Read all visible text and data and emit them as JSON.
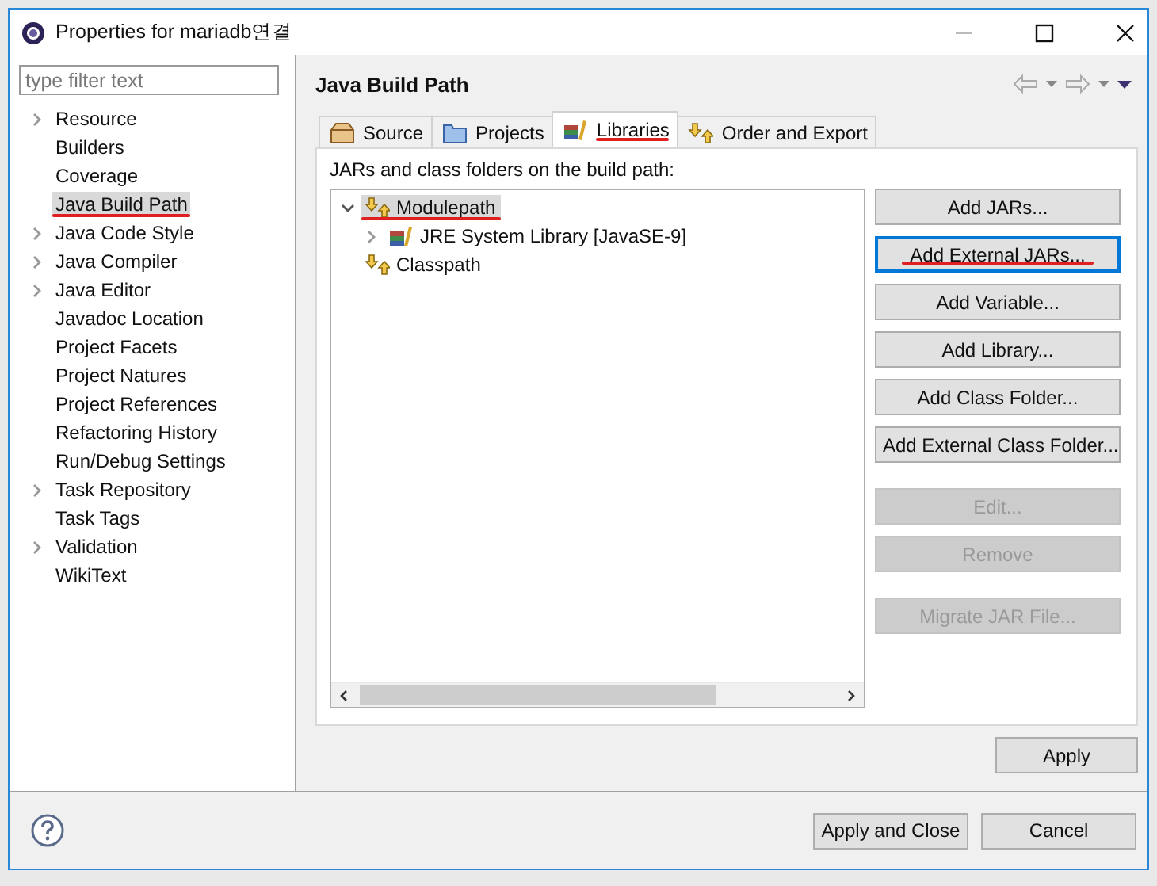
{
  "window": {
    "title": "Properties for mariadb연결"
  },
  "filter": {
    "placeholder": "type filter text"
  },
  "sidebar": {
    "items": [
      {
        "label": "Resource",
        "expandable": true,
        "selected": false,
        "underlined": false
      },
      {
        "label": "Builders",
        "expandable": false,
        "selected": false,
        "underlined": false
      },
      {
        "label": "Coverage",
        "expandable": false,
        "selected": false,
        "underlined": false
      },
      {
        "label": "Java Build Path",
        "expandable": false,
        "selected": true,
        "underlined": true
      },
      {
        "label": "Java Code Style",
        "expandable": true,
        "selected": false,
        "underlined": false
      },
      {
        "label": "Java Compiler",
        "expandable": true,
        "selected": false,
        "underlined": false
      },
      {
        "label": "Java Editor",
        "expandable": true,
        "selected": false,
        "underlined": false
      },
      {
        "label": "Javadoc Location",
        "expandable": false,
        "selected": false,
        "underlined": false
      },
      {
        "label": "Project Facets",
        "expandable": false,
        "selected": false,
        "underlined": false
      },
      {
        "label": "Project Natures",
        "expandable": false,
        "selected": false,
        "underlined": false
      },
      {
        "label": "Project References",
        "expandable": false,
        "selected": false,
        "underlined": false
      },
      {
        "label": "Refactoring History",
        "expandable": false,
        "selected": false,
        "underlined": false
      },
      {
        "label": "Run/Debug Settings",
        "expandable": false,
        "selected": false,
        "underlined": false
      },
      {
        "label": "Task Repository",
        "expandable": true,
        "selected": false,
        "underlined": false
      },
      {
        "label": "Task Tags",
        "expandable": false,
        "selected": false,
        "underlined": false
      },
      {
        "label": "Validation",
        "expandable": true,
        "selected": false,
        "underlined": false
      },
      {
        "label": "WikiText",
        "expandable": false,
        "selected": false,
        "underlined": false
      }
    ]
  },
  "page": {
    "title": "Java Build Path"
  },
  "tabs": [
    {
      "label": "Source",
      "kind": "source",
      "selected": false,
      "underlined": false
    },
    {
      "label": "Projects",
      "kind": "projects",
      "selected": false,
      "underlined": false
    },
    {
      "label": "Libraries",
      "kind": "libraries",
      "selected": true,
      "underlined": true
    },
    {
      "label": "Order and Export",
      "kind": "order",
      "selected": false,
      "underlined": false
    }
  ],
  "description": "JARs and class folders on the build path:",
  "tree": [
    {
      "label": "Modulepath",
      "kind": "path",
      "expanded": true,
      "selected": true,
      "underlined": true,
      "children": [
        {
          "label": "JRE System Library [JavaSE-9]",
          "kind": "library",
          "expanded": false,
          "selected": false,
          "underlined": false
        }
      ]
    },
    {
      "label": "Classpath",
      "kind": "path",
      "selected": false,
      "underlined": false
    }
  ],
  "button_groups": [
    [
      {
        "label": "Add JARs...",
        "disabled": false,
        "focused": false,
        "underlined": false
      },
      {
        "label": "Add External JARs...",
        "disabled": false,
        "focused": true,
        "underlined": true
      },
      {
        "label": "Add Variable...",
        "disabled": false,
        "focused": false,
        "underlined": false
      },
      {
        "label": "Add Library...",
        "disabled": false,
        "focused": false,
        "underlined": false
      },
      {
        "label": "Add Class Folder...",
        "disabled": false,
        "focused": false,
        "underlined": false
      },
      {
        "label": "Add External Class Folder...",
        "disabled": false,
        "focused": false,
        "underlined": false
      }
    ],
    [
      {
        "label": "Edit...",
        "disabled": true,
        "focused": false,
        "underlined": false
      },
      {
        "label": "Remove",
        "disabled": true,
        "focused": false,
        "underlined": false
      }
    ],
    [
      {
        "label": "Migrate JAR File...",
        "disabled": true,
        "focused": false,
        "underlined": false
      }
    ]
  ],
  "apply": "Apply",
  "footer_buttons": [
    "Apply and Close",
    "Cancel"
  ]
}
